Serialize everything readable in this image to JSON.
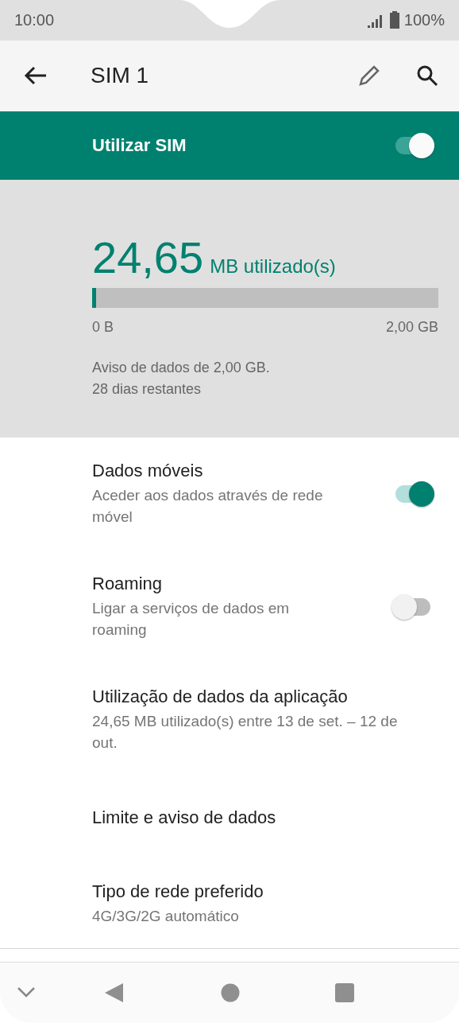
{
  "status_bar": {
    "time": "10:00",
    "battery": "100%"
  },
  "toolbar": {
    "title": "SIM 1"
  },
  "master_switch": {
    "label": "Utilizar SIM",
    "on": true
  },
  "usage": {
    "amount": "24,65",
    "unit": "MB utilizado(s)",
    "level": 0.012,
    "min_label": "0 B",
    "max_label": "2,00 GB",
    "lines": [
      "Aviso de dados de 2,00 GB.",
      "28 dias restantes"
    ]
  },
  "settings": [
    {
      "kind": "switch",
      "title": "Dados móveis",
      "summary": "Aceder aos dados através de rede móvel",
      "on": true
    },
    {
      "kind": "switch",
      "title": "Roaming",
      "summary": "Ligar a serviços de dados em roaming",
      "on": false
    },
    {
      "kind": "text",
      "title": "Utilização de dados da aplicação",
      "summary": "24,65 MB utilizado(s) entre 13 de set. – 12 de out."
    },
    {
      "kind": "text",
      "title": "Limite e aviso de dados"
    },
    {
      "kind": "text",
      "title": "Tipo de rede preferido",
      "summary": "4G/3G/2G automático"
    }
  ]
}
